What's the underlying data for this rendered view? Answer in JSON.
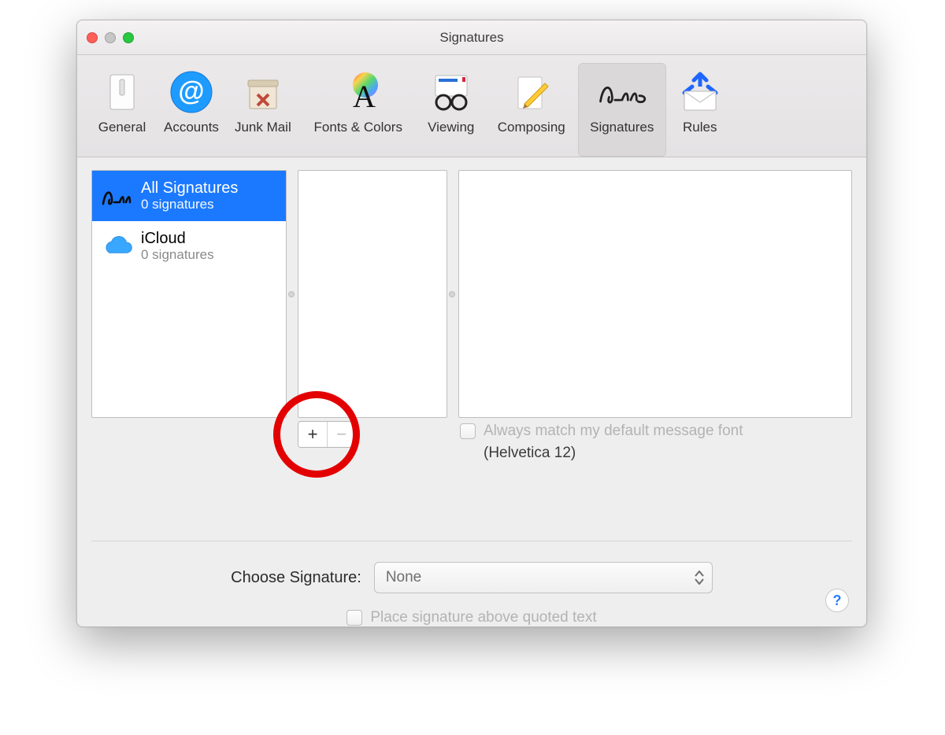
{
  "window": {
    "title": "Signatures"
  },
  "toolbar": {
    "items": [
      {
        "label": "General"
      },
      {
        "label": "Accounts"
      },
      {
        "label": "Junk Mail"
      },
      {
        "label": "Fonts & Colors"
      },
      {
        "label": "Viewing"
      },
      {
        "label": "Composing"
      },
      {
        "label": "Signatures"
      },
      {
        "label": "Rules"
      }
    ],
    "active_index": 6
  },
  "accounts": [
    {
      "name": "All Signatures",
      "sub": "0 signatures",
      "icon": "signature"
    },
    {
      "name": "iCloud",
      "sub": "0 signatures",
      "icon": "icloud"
    }
  ],
  "match_font": {
    "label": "Always match my default message font",
    "font_note": "(Helvetica 12)"
  },
  "chooser": {
    "label": "Choose Signature:",
    "value": "None"
  },
  "place_above": {
    "label": "Place signature above quoted text"
  },
  "help": "?"
}
